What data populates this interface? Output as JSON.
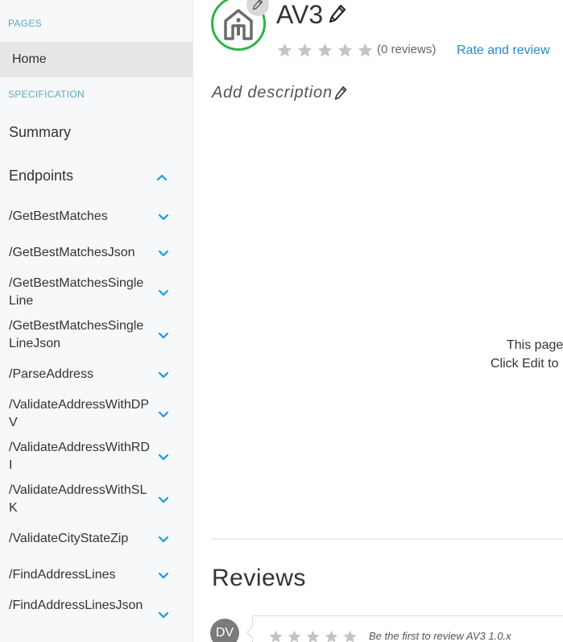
{
  "sidebar": {
    "pages_header": "PAGES",
    "home": "Home",
    "spec_header": "SPECIFICATION",
    "summary": "Summary",
    "endpoints_label": "Endpoints",
    "endpoints": [
      {
        "label": "/GetBestMatches"
      },
      {
        "label": "/GetBestMatchesJson"
      },
      {
        "label": "/GetBestMatchesSingleLine"
      },
      {
        "label": "/GetBestMatchesSingleLineJson"
      },
      {
        "label": "/ParseAddress"
      },
      {
        "label": "/ValidateAddressWithDPV"
      },
      {
        "label": "/ValidateAddressWithRDI"
      },
      {
        "label": "/ValidateAddressWithSLK"
      },
      {
        "label": "/ValidateCityStateZip"
      },
      {
        "label": "/FindAddressLines"
      },
      {
        "label": "/FindAddressLinesJson"
      }
    ]
  },
  "header": {
    "title": "AV3",
    "review_count": "(0 reviews)",
    "rate_link": "Rate and review",
    "add_description": "Add description"
  },
  "empty_state": {
    "line1": "This page",
    "line2": "Click Edit to"
  },
  "reviews": {
    "heading": "Reviews",
    "avatar_initials": "DV",
    "prompt": "Be the first to review AV3 1.0.x"
  },
  "colors": {
    "accent": "#2a8ac6",
    "section_header": "#5fa7c2",
    "chevron": "#1a9bd7",
    "logo_ring": "#2db34a",
    "star": "#c4c4c4"
  },
  "icons": {
    "logo": "house-icon",
    "edit": "pencil-icon",
    "chevron_up": "chevron-up-icon",
    "chevron_down": "chevron-down-icon",
    "star": "star-icon"
  }
}
